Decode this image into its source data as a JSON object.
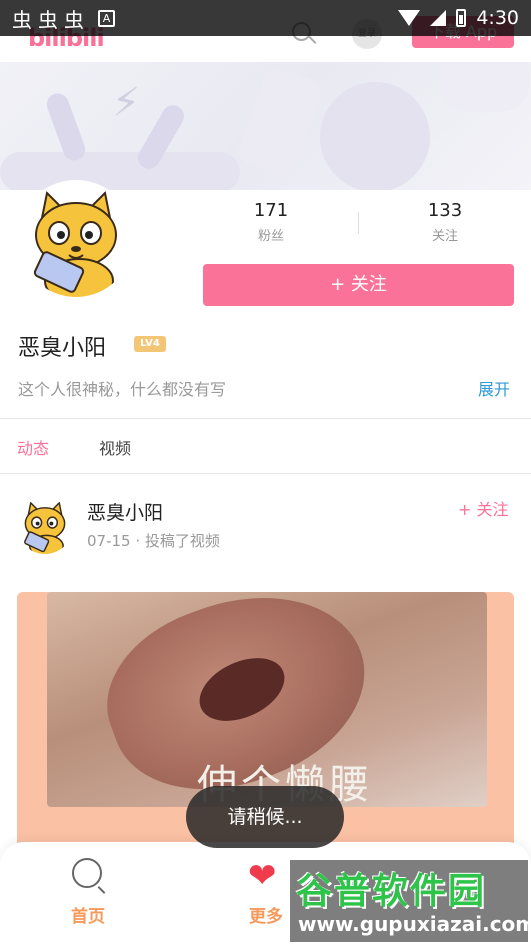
{
  "status_bar": {
    "left_icons": [
      "虫",
      "虫",
      "虫"
    ],
    "notification_icon": "A",
    "time": "4:30"
  },
  "header": {
    "logo": "bilibili",
    "login_label": "登录",
    "download_label": "下载 App"
  },
  "profile": {
    "fans_count": "171",
    "fans_label": "粉丝",
    "following_count": "133",
    "following_label": "关注",
    "follow_button": "+ 关注",
    "name": "恶臭小阳",
    "level": "LV4",
    "bio": "这个人很神秘，什么都没有写",
    "expand_label": "展开"
  },
  "tabs": [
    {
      "label": "动态",
      "active": true
    },
    {
      "label": "视频",
      "active": false
    }
  ],
  "post": {
    "author": "恶臭小阳",
    "meta": "07-15 · 投稿了视频",
    "follow_label": "+ 关注",
    "thumbnail_caption": "伸个懒腰"
  },
  "toast": "请稍候...",
  "bottom_nav": [
    {
      "label": "首页",
      "icon": "search-icon"
    },
    {
      "label": "更多",
      "icon": "heart-icon"
    }
  ],
  "watermark": {
    "title": "谷普软件园",
    "url": "www.gupuxiazai.com"
  },
  "colors": {
    "accent": "#fb7299",
    "link": "#2e9bd6",
    "nav_label": "#f69a5c",
    "heart": "#f03b4d"
  }
}
